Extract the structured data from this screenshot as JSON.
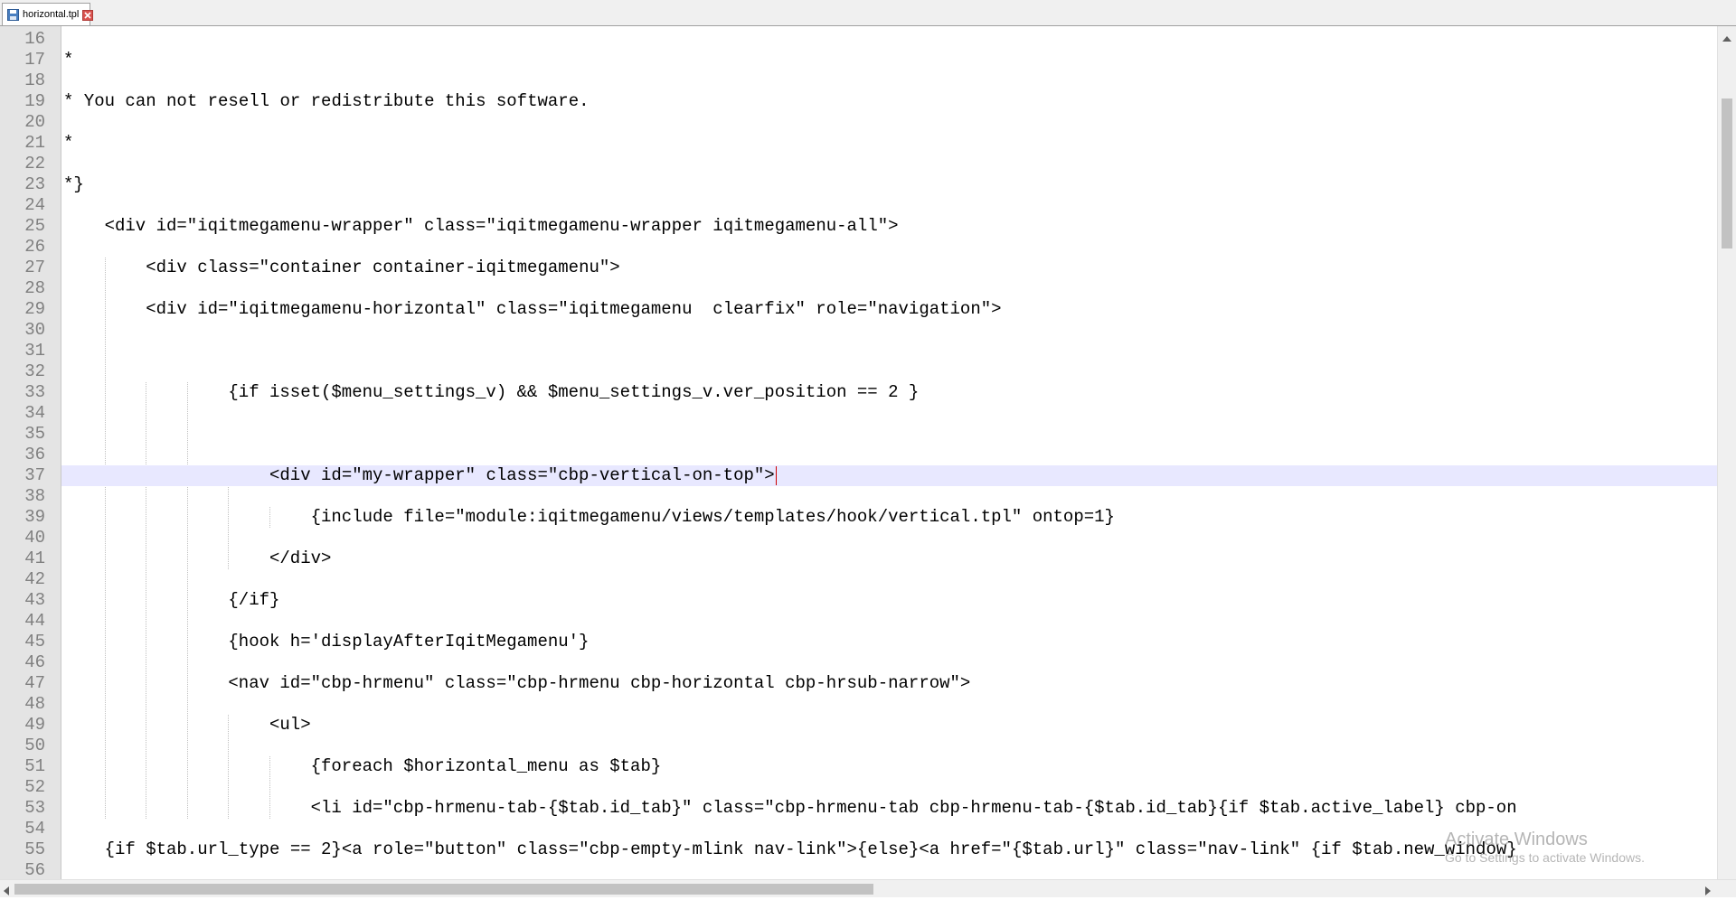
{
  "tab": {
    "filename": "horizontal.tpl",
    "icon": "save-file-icon",
    "close_icon": "close-tab-icon"
  },
  "editor": {
    "current_line": 37,
    "lines": [
      {
        "n": "16",
        "indent": 0,
        "text": ""
      },
      {
        "n": "17",
        "indent": 0,
        "text": "*"
      },
      {
        "n": "18",
        "indent": 0,
        "text": ""
      },
      {
        "n": "19",
        "indent": 0,
        "text": "* You can not resell or redistribute this software."
      },
      {
        "n": "20",
        "indent": 0,
        "text": ""
      },
      {
        "n": "21",
        "indent": 0,
        "text": "*"
      },
      {
        "n": "22",
        "indent": 0,
        "text": ""
      },
      {
        "n": "23",
        "indent": 0,
        "text": "*}"
      },
      {
        "n": "24",
        "indent": 0,
        "text": ""
      },
      {
        "n": "25",
        "indent": 1,
        "text": "<div id=\"iqitmegamenu-wrapper\" class=\"iqitmegamenu-wrapper iqitmegamenu-all\">"
      },
      {
        "n": "26",
        "indent": 0,
        "text": ""
      },
      {
        "n": "27",
        "indent": 2,
        "text": "<div class=\"container container-iqitmegamenu\">"
      },
      {
        "n": "28",
        "indent": 0,
        "text": ""
      },
      {
        "n": "29",
        "indent": 2,
        "text": "<div id=\"iqitmegamenu-horizontal\" class=\"iqitmegamenu  clearfix\" role=\"navigation\">"
      },
      {
        "n": "30",
        "indent": 0,
        "text": ""
      },
      {
        "n": "31",
        "indent": 0,
        "text": ""
      },
      {
        "n": "32",
        "indent": 0,
        "text": ""
      },
      {
        "n": "33",
        "indent": 4,
        "text": "{if isset($menu_settings_v) && $menu_settings_v.ver_position == 2 }"
      },
      {
        "n": "34",
        "indent": 0,
        "text": ""
      },
      {
        "n": "35",
        "indent": 0,
        "text": ""
      },
      {
        "n": "36",
        "indent": 0,
        "text": ""
      },
      {
        "n": "37",
        "indent": 5,
        "text": "<div id=\"my-wrapper\" class=\"cbp-vertical-on-top\">"
      },
      {
        "n": "38",
        "indent": 0,
        "text": ""
      },
      {
        "n": "39",
        "indent": 6,
        "text": "{include file=\"module:iqitmegamenu/views/templates/hook/vertical.tpl\" ontop=1}"
      },
      {
        "n": "40",
        "indent": 0,
        "text": ""
      },
      {
        "n": "41",
        "indent": 5,
        "text": "</div>"
      },
      {
        "n": "42",
        "indent": 0,
        "text": ""
      },
      {
        "n": "43",
        "indent": 4,
        "text": "{/if}"
      },
      {
        "n": "44",
        "indent": 0,
        "text": ""
      },
      {
        "n": "45",
        "indent": 4,
        "text": "{hook h='displayAfterIqitMegamenu'}"
      },
      {
        "n": "46",
        "indent": 0,
        "text": ""
      },
      {
        "n": "47",
        "indent": 4,
        "text": "<nav id=\"cbp-hrmenu\" class=\"cbp-hrmenu cbp-horizontal cbp-hrsub-narrow\">"
      },
      {
        "n": "48",
        "indent": 0,
        "text": ""
      },
      {
        "n": "49",
        "indent": 5,
        "text": "<ul>"
      },
      {
        "n": "50",
        "indent": 0,
        "text": ""
      },
      {
        "n": "51",
        "indent": 6,
        "text": "{foreach $horizontal_menu as $tab}"
      },
      {
        "n": "52",
        "indent": 0,
        "text": ""
      },
      {
        "n": "53",
        "indent": 6,
        "text": "<li id=\"cbp-hrmenu-tab-{$tab.id_tab}\" class=\"cbp-hrmenu-tab cbp-hrmenu-tab-{$tab.id_tab}{if $tab.active_label} cbp-on"
      },
      {
        "n": "54",
        "indent": 0,
        "text": ""
      },
      {
        "n": "55",
        "indent": 1,
        "text": "{if $tab.url_type == 2}<a role=\"button\" class=\"cbp-empty-mlink nav-link\">{else}<a href=\"{$tab.url}\" class=\"nav-link\" {if $tab.new_window}"
      },
      {
        "n": "56",
        "indent": 0,
        "text": ""
      }
    ]
  },
  "watermark": {
    "title": "Activate Windows",
    "subtitle": "Go to Settings to activate Windows."
  },
  "scrollbars": {
    "vertical_icon": "scroll-up-icon",
    "horizontal_left_icon": "scroll-left-icon",
    "horizontal_right_icon": "scroll-right-icon"
  }
}
